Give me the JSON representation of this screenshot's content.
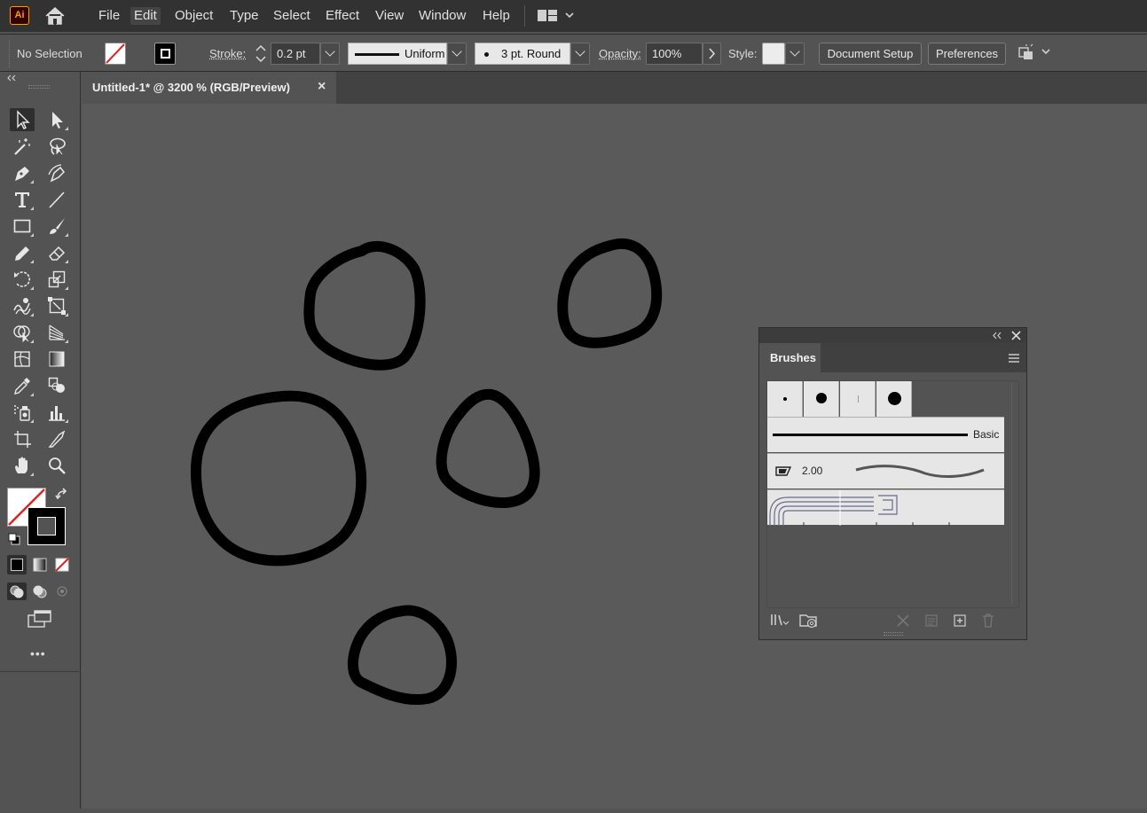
{
  "app": {
    "logo_text": "Ai"
  },
  "menu": {
    "items": [
      {
        "label": "File"
      },
      {
        "label": "Edit",
        "active": true
      },
      {
        "label": "Object"
      },
      {
        "label": "Type"
      },
      {
        "label": "Select"
      },
      {
        "label": "Effect"
      },
      {
        "label": "View"
      },
      {
        "label": "Window"
      },
      {
        "label": "Help"
      }
    ]
  },
  "control_bar": {
    "selection_status": "No Selection",
    "stroke_label": "Stroke:",
    "stroke_weight": "0.2 pt",
    "variable_width_profile": "Uniform",
    "brush_definition": "3 pt. Round",
    "opacity_label": "Opacity:",
    "opacity_value": "100%",
    "style_label": "Style:",
    "document_setup_label": "Document Setup",
    "preferences_label": "Preferences"
  },
  "document_tab": {
    "title": "Untitled-1* @ 3200 % (RGB/Preview)",
    "close_glyph": "×"
  },
  "toolbar": {
    "tools": [
      "selection-tool",
      "direct-selection-tool",
      "magic-wand-tool",
      "lasso-tool",
      "pen-tool",
      "curvature-tool",
      "type-tool",
      "line-segment-tool",
      "rectangle-tool",
      "paintbrush-tool",
      "pencil-tool",
      "eraser-tool",
      "rotate-tool",
      "scale-tool",
      "warp-tool",
      "free-transform-tool",
      "shape-builder-tool",
      "perspective-grid-tool",
      "mesh-tool",
      "gradient-tool",
      "eyedropper-tool",
      "blend-tool",
      "symbol-sprayer-tool",
      "column-graph-tool",
      "artboard-tool",
      "slice-tool",
      "hand-tool",
      "zoom-tool"
    ],
    "more_tools_glyph": "•••"
  },
  "brushes_panel": {
    "title": "Brushes",
    "basic_label": "Basic",
    "calligraphic_size": "2.00"
  },
  "colors": {
    "menu_bg": "#323232",
    "ui_bg": "#535353",
    "canvas_bg": "#5a5a5a",
    "accent_orange": "#ff9a00",
    "none_red": "#e02020"
  }
}
